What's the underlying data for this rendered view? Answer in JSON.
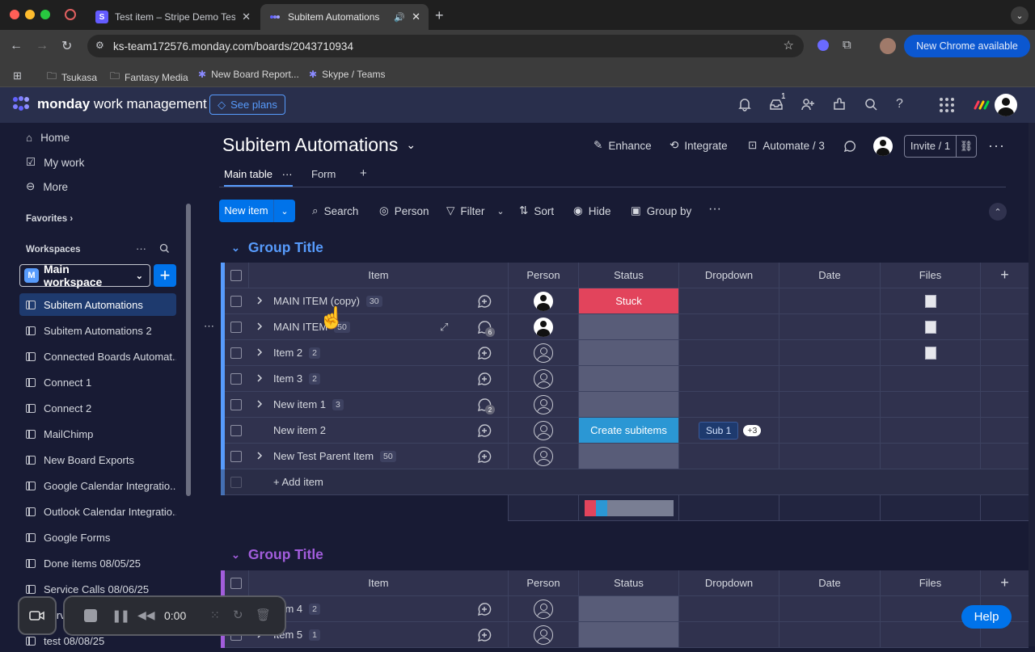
{
  "browser": {
    "tabs": [
      {
        "title": "Test item – Stripe Demo Test",
        "favicon": "S",
        "active": false
      },
      {
        "title": "Subitem Automations",
        "favicon": "m",
        "active": true
      }
    ],
    "url": "ks-team172576.monday.com/boards/2043710934",
    "update_label": "New Chrome available",
    "bookmarks": [
      "Tsukasa",
      "Fantasy Media",
      "New Board Report...",
      "Skype / Teams"
    ]
  },
  "app": {
    "brand_bold": "monday",
    "brand_light": "work management",
    "see_plans": "See plans",
    "inbox_badge": "1"
  },
  "sidebar": {
    "nav": [
      "Home",
      "My work",
      "More"
    ],
    "favorites": "Favorites",
    "workspaces": "Workspaces",
    "workspace_name": "Main workspace",
    "workspace_letter": "M",
    "boards": [
      "Subitem Automations",
      "Subitem Automations 2",
      "Connected Boards Automat...",
      "Connect 1",
      "Connect 2",
      "MailChimp",
      "New Board Exports",
      "Google Calendar Integratio...",
      "Outlook Calendar Integratio...",
      "Google Forms",
      "Done items 08/05/25",
      "Service Calls 08/06/25",
      "Servic",
      "test 08/08/25"
    ]
  },
  "board": {
    "title": "Subitem Automations",
    "enhance": "Enhance",
    "integrate": "Integrate",
    "automate": "Automate / 3",
    "invite": "Invite / 1",
    "views": [
      "Main table",
      "Form"
    ],
    "new_item": "New item",
    "toolbar": [
      "Search",
      "Person",
      "Filter",
      "Sort",
      "Hide",
      "Group by"
    ],
    "columns": [
      "Item",
      "Person",
      "Status",
      "Dropdown",
      "Date",
      "Files"
    ],
    "add_item": "+ Add item",
    "colors": {
      "stuck": "#e2445c",
      "create": "#2b97d4",
      "group1": "#579bfc",
      "group2": "#a25ddc"
    },
    "group1": {
      "title": "Group Title",
      "rows": [
        {
          "name": "MAIN ITEM (copy)",
          "count": "30",
          "expand": true,
          "person": "full",
          "status": "Stuck",
          "dropdown": "",
          "dropdown_more": "",
          "file": true,
          "updates": ""
        },
        {
          "name": "MAIN ITEM",
          "count": "50",
          "expand": true,
          "person": "full",
          "status": "",
          "dropdown": "",
          "dropdown_more": "",
          "file": true,
          "updates": "6"
        },
        {
          "name": "Item 2",
          "count": "2",
          "expand": true,
          "person": "empty",
          "status": "",
          "dropdown": "",
          "dropdown_more": "",
          "file": true,
          "updates": ""
        },
        {
          "name": "Item 3",
          "count": "2",
          "expand": true,
          "person": "empty",
          "status": "",
          "dropdown": "",
          "dropdown_more": "",
          "file": false,
          "updates": ""
        },
        {
          "name": "New item 1",
          "count": "3",
          "expand": true,
          "person": "empty",
          "status": "",
          "dropdown": "",
          "dropdown_more": "",
          "file": false,
          "updates": "2"
        },
        {
          "name": "New item 2",
          "count": "",
          "expand": false,
          "person": "empty",
          "status": "Create subitems",
          "dropdown": "Sub 1",
          "dropdown_more": "+3",
          "file": false,
          "updates": ""
        },
        {
          "name": "New Test Parent Item",
          "count": "50",
          "expand": true,
          "person": "empty",
          "status": "",
          "dropdown": "",
          "dropdown_more": "",
          "file": false,
          "updates": ""
        }
      ]
    },
    "group2": {
      "title": "Group Title",
      "rows": [
        {
          "name": "Item 4",
          "count": "2"
        },
        {
          "name": "Item 5",
          "count": "1"
        }
      ]
    }
  },
  "recorder": {
    "time": "0:00"
  },
  "help": "Help"
}
